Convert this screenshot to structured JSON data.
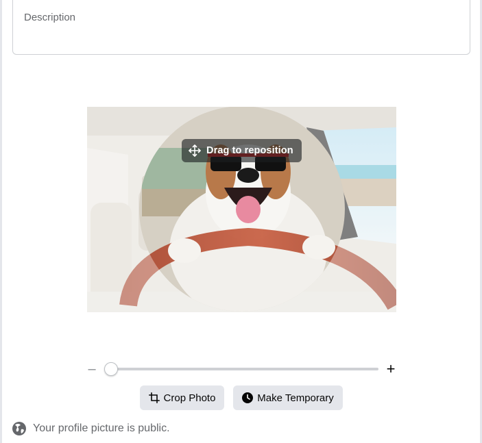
{
  "description": {
    "placeholder": "Description",
    "value": ""
  },
  "editor": {
    "drag_hint": "Drag to reposition",
    "move_icon": "move-arrows-icon"
  },
  "zoom": {
    "minus_label": "–",
    "plus_label": "+",
    "level": 0.0
  },
  "actions": {
    "crop_label": "Crop Photo",
    "crop_icon": "crop-icon",
    "temporary_label": "Make Temporary",
    "temporary_icon": "clock-icon"
  },
  "privacy": {
    "text": "Your profile picture is public.",
    "icon": "globe-icon"
  },
  "colors": {
    "button_bg": "#e4e6eb",
    "secondary_text": "#65676b",
    "hint_overlay": "#1c1e21"
  }
}
